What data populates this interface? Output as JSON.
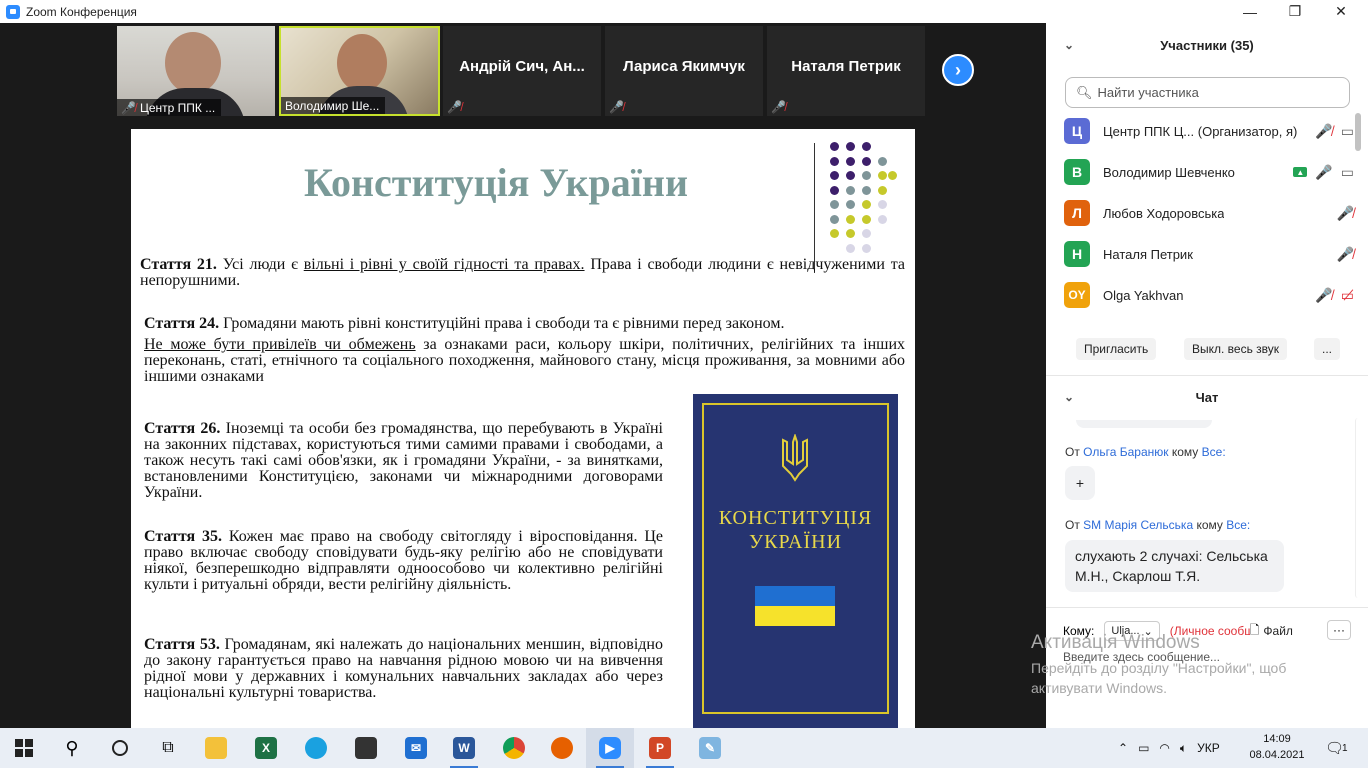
{
  "window": {
    "title": "Zoom Конференция",
    "minimize": "—",
    "maximize": "❐",
    "close": "✕"
  },
  "video_strip": {
    "tiles": [
      {
        "name": "Центр ППК ..."
      },
      {
        "name": "Володимир Ше..."
      },
      {
        "name": "Андрій Сич, Ан..."
      },
      {
        "name": "Лариса Якимчук"
      },
      {
        "name": "Наталя Петрик"
      }
    ],
    "next_arrow": "›"
  },
  "slide": {
    "title": "Конституція України",
    "art21_label": "Стаття 21.",
    "art21_pre": " Усі люди є ",
    "art21_underlined": "вільні і рівні у своїй гідності та правах.",
    "art21_post": " Права і свободи людини є невідчуженими та непорушними.",
    "art24_label": "Стаття 24.",
    "art24_text": " Громадяни мають рівні конституційні права і свободи та є рівними перед законом.",
    "art24_underlined": "Не може бути привілеїв чи обмежень",
    "art24_post": " за ознаками раси, кольору шкіри, політичних, релігійних та інших переконань, статі, етнічного та соціального походження, майнового стану, місця проживання, за мовними або іншими ознаками",
    "art26_label": "Стаття 26.",
    "art26_text": " Іноземці та особи без громадянства, що перебувають в Україні на законних підставах, користуються тими самими правами і свободами, а також несуть такі самі обов'язки, як і громадяни України, - за винятками, встановленими Конституцією, законами чи міжнародними договорами України.",
    "art35_label": "Стаття 35.",
    "art35_text": " Кожен має право на свободу світогляду і віросповідання. Це право включає свободу сповідувати будь-яку релігію або не сповідувати ніякої, безперешкодно відправляти одноособово чи колективно релігійні культи і ритуальні обряди, вести релігійну діяльність.",
    "art53_label": "Стаття 53.",
    "art53_text": " Громадянам, які належать до національних меншин, відповідно до закону гарантується право на навчання рідною мовою чи на вивчення рідної мови у державних і комунальних навчальних закладах або через національні культурні товариства.",
    "book_line1": "КОНСТИТУЦІЯ",
    "book_line2": "УКРАЇНИ"
  },
  "participants": {
    "header": "Участники (35)",
    "search_placeholder": "Найти участника",
    "list": [
      {
        "initial": "Ц",
        "color": "#5b6bd4",
        "name": "Центр ППК Ц... (Организатор, я)"
      },
      {
        "initial": "В",
        "color": "#23a454",
        "name": "Володимир Шевченко"
      },
      {
        "initial": "Л",
        "color": "#e0620d",
        "name": "Любов Ходоровська"
      },
      {
        "initial": "Н",
        "color": "#23a454",
        "name": "Наталя Петрик"
      },
      {
        "initial": "OY",
        "color": "#f0a20b",
        "name": "Olga Yakhvan"
      }
    ],
    "invite_button": "Пригласить",
    "mute_all_button": "Выкл. весь звук",
    "more_button": "..."
  },
  "chat": {
    "header": "Чат",
    "messages": [
      {
        "from_prefix": "От ",
        "sender": "Ольга Баранюк",
        "to_word": " кому ",
        "to": "Все:",
        "text": "+"
      },
      {
        "from_prefix": "От ",
        "sender": "SM Марія Сельська",
        "to_word": " кому ",
        "to": "Все:",
        "text_line1": "слухають 2 случахі: Сельська",
        "text_line2": "М.Н., Скарлош Т.Я."
      }
    ],
    "to_label": "Кому:",
    "to_value": "Ulja...",
    "private_label": "(Личное сообщение)",
    "file_label": "Файл",
    "more": "···",
    "input_placeholder": "Введите здесь сообщение..."
  },
  "activation": {
    "line1": "Активація Windows",
    "line2": "Перейдіть до розділу \"Настройки\", щоб",
    "line3": "активувати Windows."
  },
  "taskbar": {
    "lang": "УКР",
    "time": "14:09",
    "date": "08.04.2021",
    "notif_count": "1"
  }
}
